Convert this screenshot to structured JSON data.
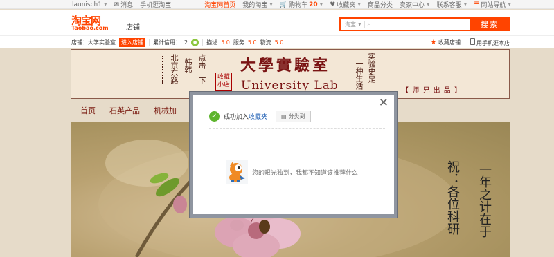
{
  "site_nav": {
    "user": "launisch1",
    "messages": "消息",
    "mobile": "手机逛淘宝",
    "home": "淘宝网首页",
    "my_taobao": "我的淘宝",
    "cart_label": "购物车",
    "cart_count": "20",
    "favorites": "收藏夹",
    "categories": "商品分类",
    "seller_center": "卖家中心",
    "service": "联系客服",
    "site_nav": "网站导航"
  },
  "header": {
    "logo_cn": "淘宝网",
    "logo_en": "Taobao.com",
    "shop_word": "店铺",
    "search_category": "淘宝",
    "search_button": "搜索"
  },
  "shop_bar": {
    "shop_label": "店铺：",
    "shop_name": "大学实验室",
    "enter_shop": "进入店铺",
    "credit_label": "累计信用：",
    "credit_value": "2",
    "desc_label": "描述",
    "desc_score": "5.0",
    "service_label": "服务",
    "service_score": "5.0",
    "logistics_label": "物流",
    "logistics_score": "5.0",
    "favorite_shop": "收藏店铺",
    "mobile_shop": "用手机逛本店"
  },
  "banner": {
    "title_cn": "大學實驗室",
    "title_en": "University Lab",
    "tagline": "【 师 兄 出 品 】",
    "col1": "北京东路",
    "col2": "韩韩",
    "col3": "点击一下",
    "seal": "收藏小店",
    "col4": "一种生活",
    "col5": "实验史是"
  },
  "shop_nav": {
    "items": [
      "首页",
      "石英产品",
      "机械加"
    ]
  },
  "hero": {
    "poem_left": "祝：各位科研",
    "poem_right": "一年之计在于"
  },
  "modal": {
    "success_prefix": "成功加入",
    "success_link": "收藏夹",
    "category_button": "分类到",
    "empty_text": "您的眼光独到，我都不知道该推荐什么"
  },
  "colors": {
    "brand": "#ff4400",
    "success": "#5db42d",
    "link": "#1f5fb4"
  }
}
